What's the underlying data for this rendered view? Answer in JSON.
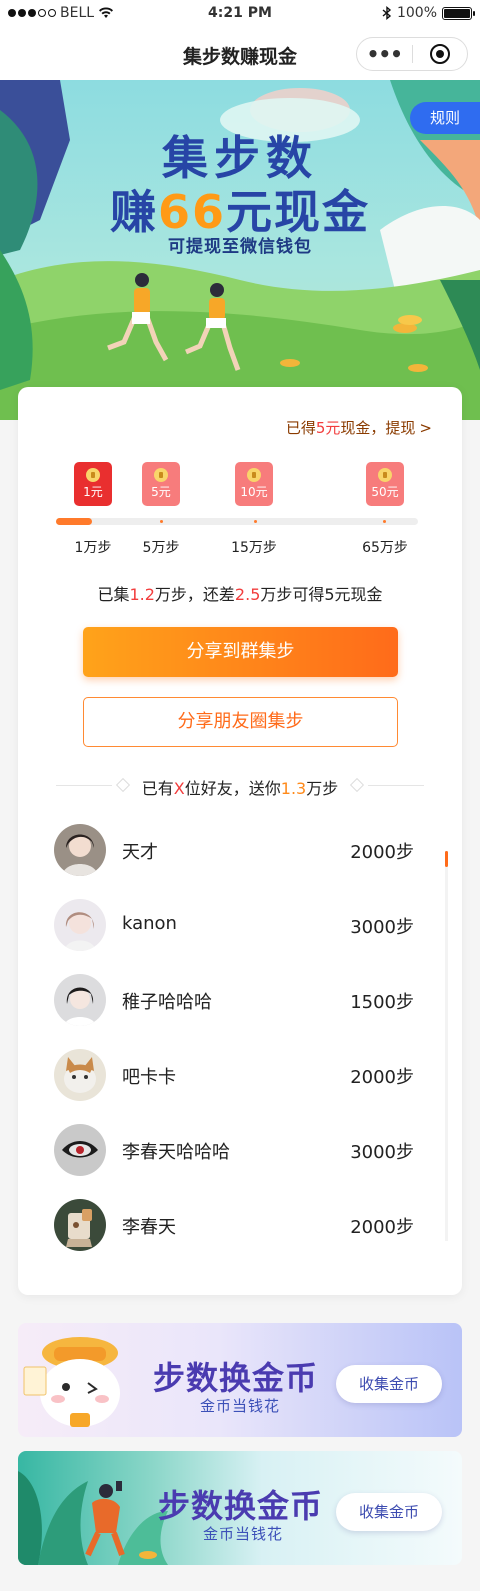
{
  "status_bar": {
    "carrier": "BELL",
    "time": "4:21 PM",
    "battery": "100%"
  },
  "nav": {
    "title": "集步数赚现金",
    "more_label": "•••"
  },
  "hero": {
    "rules_label": "规则",
    "line1": "集步数",
    "line2_prefix": "赚",
    "line2_highlight": "66",
    "line2_suffix": "元现金",
    "subtitle": "可提现至微信钱包"
  },
  "reward": {
    "earned_prefix": "已得",
    "earned_amount": "5元",
    "earned_suffix": "现金，提现",
    "arrow": ">",
    "packets": [
      {
        "amount": "1元",
        "status": "active"
      },
      {
        "amount": "5元",
        "status": "inactive"
      },
      {
        "amount": "10元",
        "status": "inactive"
      },
      {
        "amount": "50元",
        "status": "inactive"
      }
    ],
    "milestones": [
      "1万步",
      "5万步",
      "15万步",
      "65万步"
    ],
    "progress_fraction": 0.1,
    "message": {
      "p1": "已集",
      "collected": "1.2",
      "p2": "万步，还差",
      "remaining": "2.5",
      "p3": "万步可得5元现金"
    }
  },
  "actions": {
    "share_group": "分享到群集步",
    "share_moments": "分享朋友圈集步"
  },
  "friends_header": {
    "p1": "已有",
    "count": "X",
    "p2": "位好友，送你",
    "steps": "1.3",
    "p3": "万步"
  },
  "friends": [
    {
      "name": "天才",
      "steps": "2000步"
    },
    {
      "name": "kanon",
      "steps": "3000步"
    },
    {
      "name": "稚子哈哈哈",
      "steps": "1500步"
    },
    {
      "name": "吧卡卡",
      "steps": "2000步"
    },
    {
      "name": "李春天哈哈哈",
      "steps": "3000步"
    },
    {
      "name": "李春天",
      "steps": "2000步"
    }
  ],
  "promos": [
    {
      "title": "步数换金币",
      "subtitle": "金币当钱花",
      "button": "收集金币"
    },
    {
      "title": "步数换金币",
      "subtitle": "金币当钱花",
      "button": "收集金币"
    }
  ],
  "colors": {
    "accent_orange": "#ff6b1a",
    "accent_red": "#f23d3d",
    "brand_blue": "#2f6cf0",
    "title_navy": "#2745a6"
  }
}
